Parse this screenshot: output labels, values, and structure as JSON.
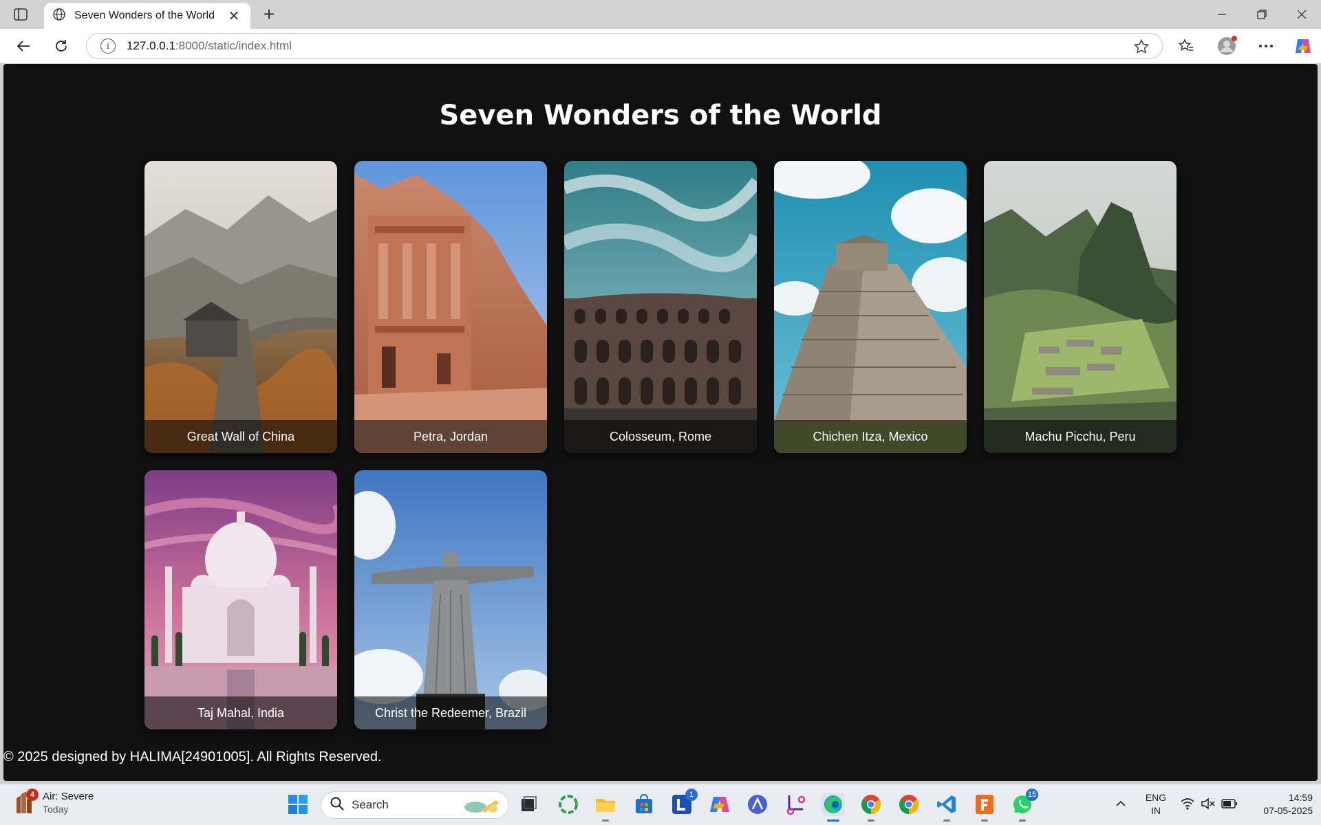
{
  "browser": {
    "tab_title": "Seven Wonders of the World",
    "url_host": "127.0.0.1",
    "url_path": ":8000/static/index.html"
  },
  "page": {
    "title": "Seven Wonders of the World",
    "footer": "© 2025 designed by HALIMA[24901005]. All Rights Reserved."
  },
  "wonders": [
    {
      "caption": "Great Wall of China"
    },
    {
      "caption": "Petra, Jordan"
    },
    {
      "caption": "Colosseum, Rome"
    },
    {
      "caption": "Chichen Itza, Mexico"
    },
    {
      "caption": "Machu Picchu, Peru"
    },
    {
      "caption": "Taj Mahal, India"
    },
    {
      "caption": "Christ the Redeemer, Brazil"
    }
  ],
  "taskbar": {
    "weather_title": "Air: Severe",
    "weather_sub": "Today",
    "weather_badge": "4",
    "search_label": "Search",
    "apps": [
      {
        "name": "task-view",
        "badge": ""
      },
      {
        "name": "copilot-ring",
        "badge": ""
      },
      {
        "name": "file-explorer",
        "badge": ""
      },
      {
        "name": "microsoft-store",
        "badge": ""
      },
      {
        "name": "l-app",
        "badge": "1"
      },
      {
        "name": "copilot",
        "badge": ""
      },
      {
        "name": "vector-app",
        "badge": ""
      },
      {
        "name": "snipping-tool",
        "badge": ""
      },
      {
        "name": "edge",
        "badge": ""
      },
      {
        "name": "chrome",
        "badge": ""
      },
      {
        "name": "chrome-2",
        "badge": ""
      },
      {
        "name": "vscode",
        "badge": ""
      },
      {
        "name": "fl-studio",
        "badge": ""
      },
      {
        "name": "whatsapp",
        "badge": "15"
      }
    ],
    "lang_line1": "ENG",
    "lang_line2": "IN",
    "time": "14:59",
    "date": "07-05-2025"
  }
}
